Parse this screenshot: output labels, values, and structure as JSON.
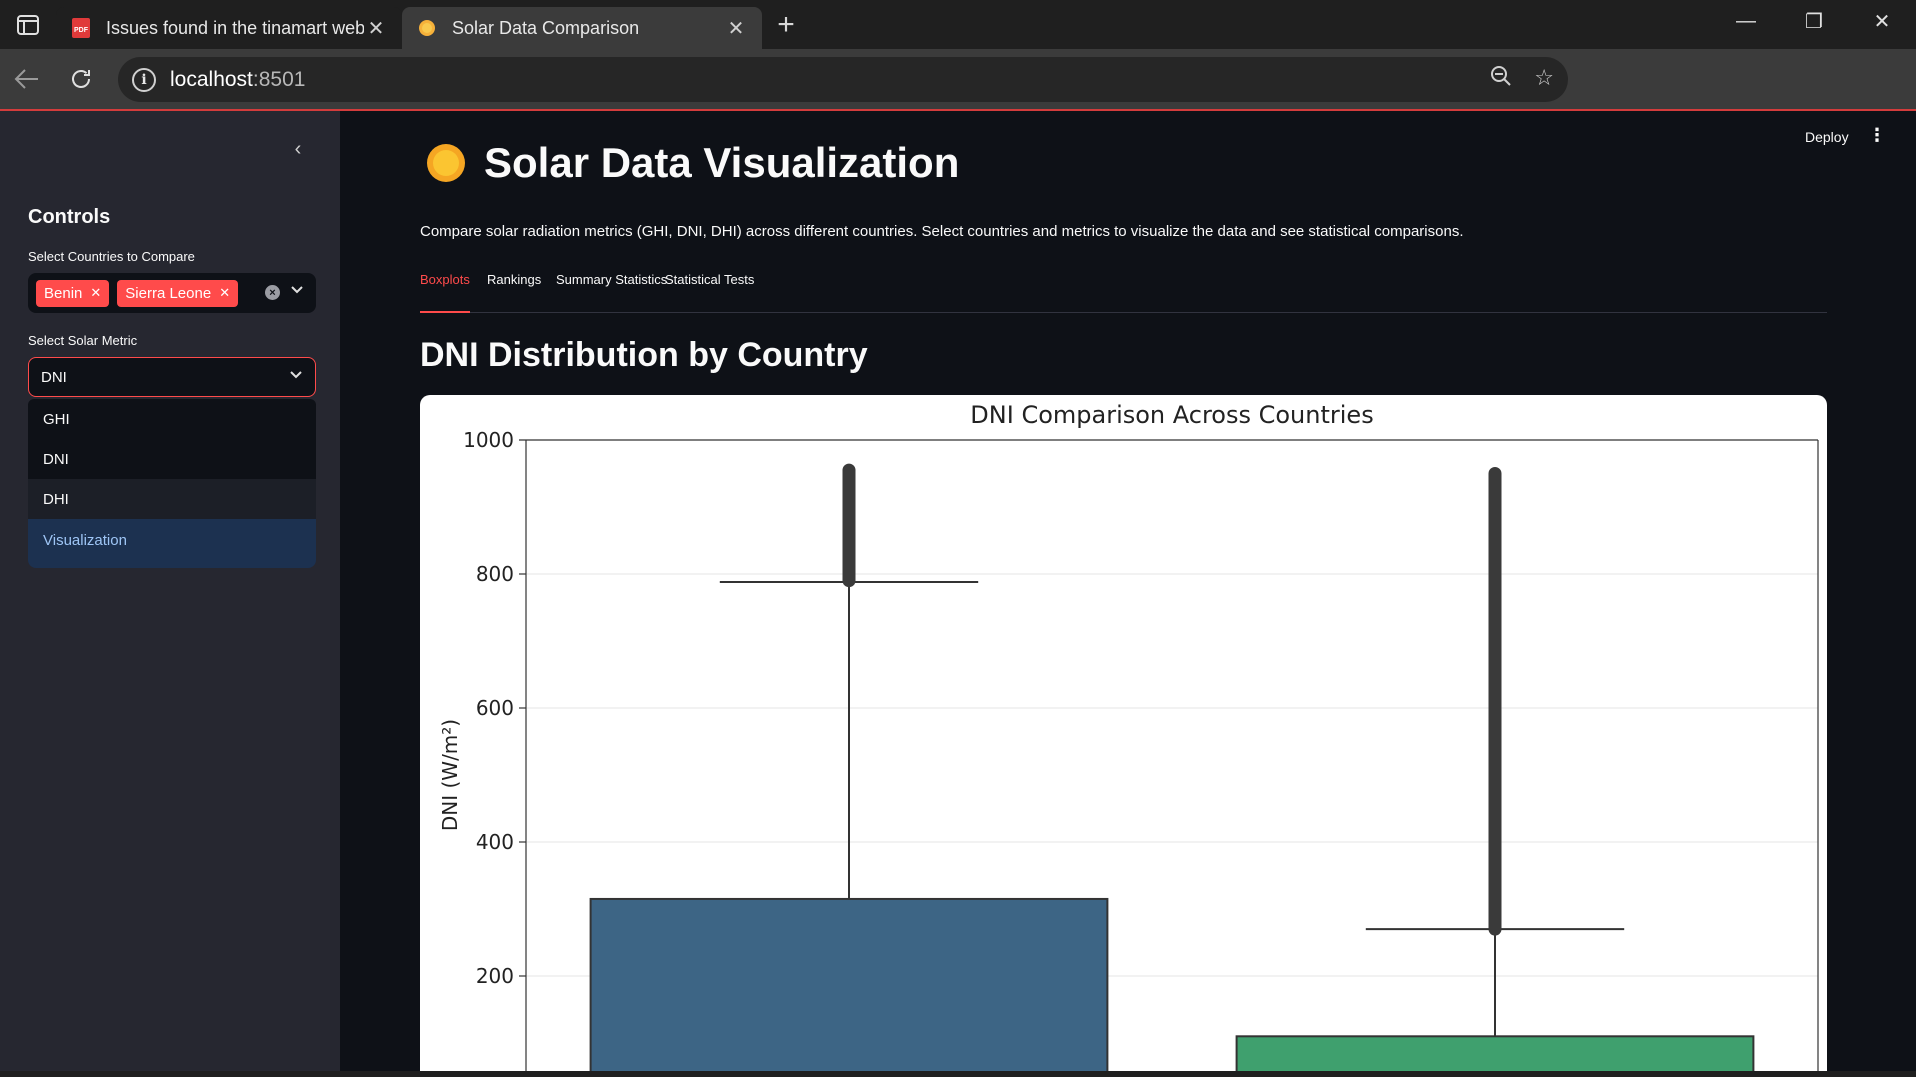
{
  "browser": {
    "tabs": [
      {
        "title": "Issues found in the tinamart webs",
        "active": false,
        "icon": "pdf-icon"
      },
      {
        "title": "Solar Data Comparison",
        "active": true,
        "icon": "sun-icon"
      }
    ],
    "address": {
      "host": "localhost",
      "port": ":8501"
    }
  },
  "app": {
    "deploy_label": "Deploy",
    "title": "Solar Data Visualization",
    "description": "Compare solar radiation metrics (GHI, DNI, DHI) across different countries. Select countries and metrics to visualize the data and see statistical comparisons.",
    "tabs": [
      "Boxplots",
      "Rankings",
      "Summary Statistics",
      "Statistical Tests"
    ],
    "active_tab": "Boxplots",
    "section_title": "DNI Distribution by Country"
  },
  "sidebar": {
    "heading": "Controls",
    "countries_label": "Select Countries to Compare",
    "selected_countries": [
      "Benin",
      "Sierra Leone"
    ],
    "metric_label": "Select Solar Metric",
    "metric_value": "DNI",
    "metric_options": [
      "GHI",
      "DNI",
      "DHI"
    ],
    "info_text": "Visualization"
  },
  "chart_data": {
    "type": "box",
    "title": "DNI Comparison Across Countries",
    "ylabel": "DNI (W/m²)",
    "xlabel": "",
    "ylim": [
      0,
      1000
    ],
    "yticks": [
      200,
      400,
      600,
      800,
      1000
    ],
    "grid": true,
    "series": [
      {
        "color": "#3d6585",
        "q3": 315,
        "upper_whisker": 788,
        "outliers_from": 790,
        "outliers_to": 955
      },
      {
        "color": "#3fa06e",
        "q3": 110,
        "upper_whisker": 270,
        "outliers_from": 270,
        "outliers_to": 950
      }
    ]
  },
  "colors": {
    "accent": "#ff4b4b",
    "sidebar_bg": "#262730",
    "main_bg": "#0e1117",
    "info_bg": "#1c3150"
  }
}
